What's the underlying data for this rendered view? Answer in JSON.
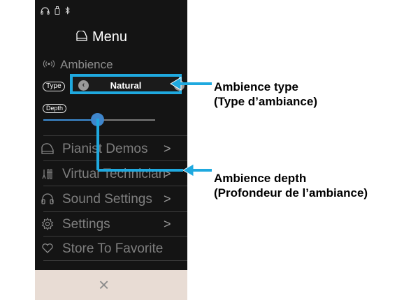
{
  "status_bar": {
    "icons": [
      "headphones-icon",
      "usb-drive-icon",
      "bluetooth-icon"
    ]
  },
  "menu": {
    "title": "Menu",
    "title_icon": "piano-icon"
  },
  "ambience": {
    "label": "Ambience",
    "icon": "ambience-waves-icon",
    "type_label": "Type",
    "type_value": "Natural",
    "depth_label": "Depth",
    "depth_level": 0.48
  },
  "menu_items": [
    {
      "label": "Pianist Demos",
      "icon": "piano-icon",
      "chevron": ">"
    },
    {
      "label": "Virtual Technician",
      "icon": "technician-icon",
      "chevron": ">"
    },
    {
      "label": "Sound Settings",
      "icon": "headphones-icon",
      "chevron": ">"
    },
    {
      "label": "Settings",
      "icon": "gear-icon",
      "chevron": ">"
    },
    {
      "label": "Store To Favorite",
      "icon": "heart-icon",
      "chevron": ""
    }
  ],
  "close_symbol": "×",
  "callouts": {
    "type_line1": "Ambience type",
    "type_line2": "(Type d’ambiance)",
    "depth_line1": "Ambience depth",
    "depth_line2": "(Profondeur de l’ambiance)"
  },
  "colors": {
    "accent": "#1fa9df",
    "slider": "#3f86cc",
    "panel_bg": "#141414",
    "bottom_bar": "#e8dcd4"
  }
}
